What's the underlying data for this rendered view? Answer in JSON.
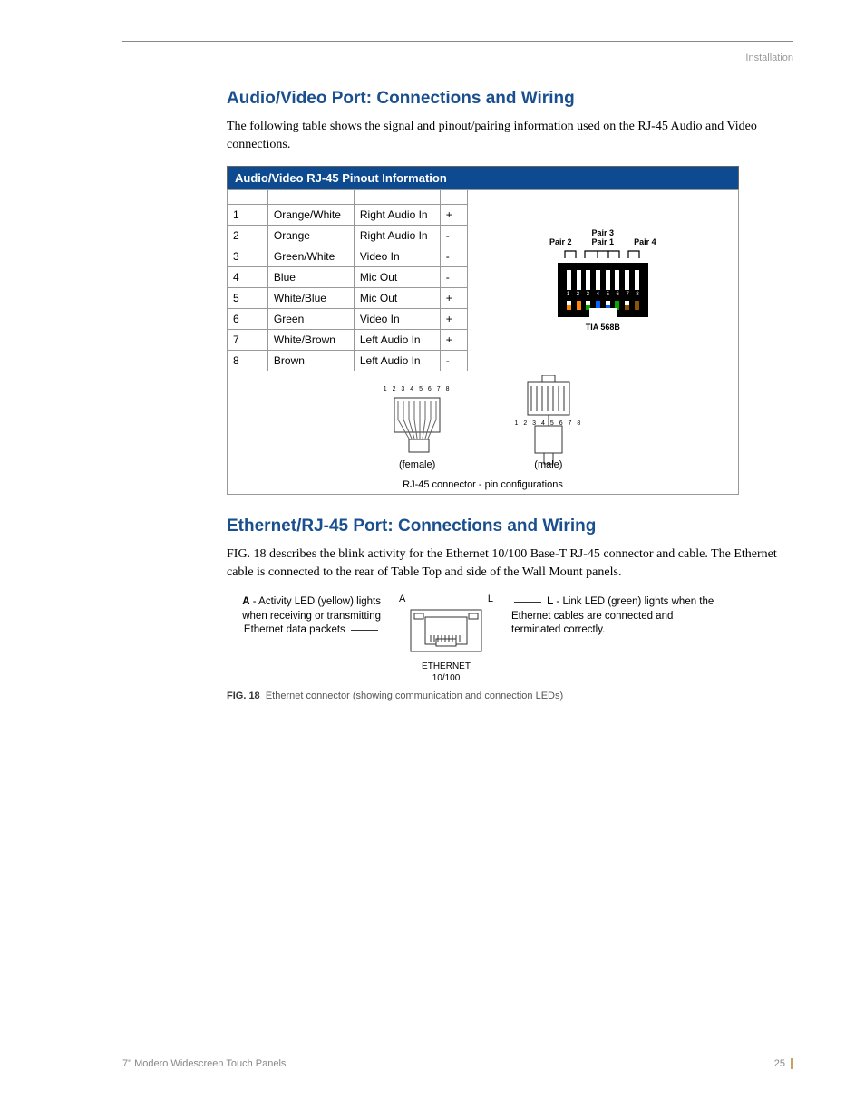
{
  "header": {
    "section": "Installation"
  },
  "section1": {
    "heading": "Audio/Video Port: Connections and Wiring",
    "intro": "The following table shows the signal and pinout/pairing information used on the RJ-45 Audio and Video connections.",
    "table_title": "Audio/Video RJ-45 Pinout Information",
    "rows": [
      {
        "pin": "1",
        "wire": "Orange/White",
        "signal": "Right Audio In",
        "pol": "+"
      },
      {
        "pin": "2",
        "wire": "Orange",
        "signal": "Right Audio In",
        "pol": "-"
      },
      {
        "pin": "3",
        "wire": "Green/White",
        "signal": "Video In",
        "pol": "-"
      },
      {
        "pin": "4",
        "wire": "Blue",
        "signal": "Mic Out",
        "pol": "-"
      },
      {
        "pin": "5",
        "wire": "White/Blue",
        "signal": "Mic Out",
        "pol": "+"
      },
      {
        "pin": "6",
        "wire": "Green",
        "signal": "Video In",
        "pol": "+"
      },
      {
        "pin": "7",
        "wire": "White/Brown",
        "signal": "Left Audio In",
        "pol": "+"
      },
      {
        "pin": "8",
        "wire": "Brown",
        "signal": "Left Audio In",
        "pol": "-"
      }
    ],
    "tia": {
      "pair3": "Pair 3",
      "pair2": "Pair 2",
      "pair1": "Pair 1",
      "pair4": "Pair 4",
      "pins": "1 2 3 4 5 6 7 8",
      "standard": "TIA 568B"
    },
    "connector_diagram": {
      "pins": "1 2 3 4 5 6 7 8",
      "female": "(female)",
      "male": "(male)",
      "caption": "RJ-45 connector - pin configurations"
    }
  },
  "section2": {
    "heading": "Ethernet/RJ-45 Port: Connections and Wiring",
    "intro": "FIG. 18 describes the blink activity for the Ethernet 10/100 Base-T RJ-45 connector and cable. The Ethernet cable is connected to the rear of Table Top and side of the Wall Mount panels.",
    "led_a_label": "A",
    "led_a_bold": "A",
    "led_a_text": " - Activity LED (yellow) lights when receiving or transmitting Ethernet data packets",
    "led_l_label": "L",
    "led_l_bold": "L",
    "led_l_text": " - Link LED (green) lights when the Ethernet cables are connected and terminated correctly.",
    "port_label1": "ETHERNET",
    "port_label2": "10/100",
    "fig_label": "FIG. 18",
    "fig_caption": "Ethernet connector (showing communication and connection LEDs)"
  },
  "footer": {
    "doc_title": "7\" Modero Widescreen Touch Panels",
    "page": "25"
  }
}
